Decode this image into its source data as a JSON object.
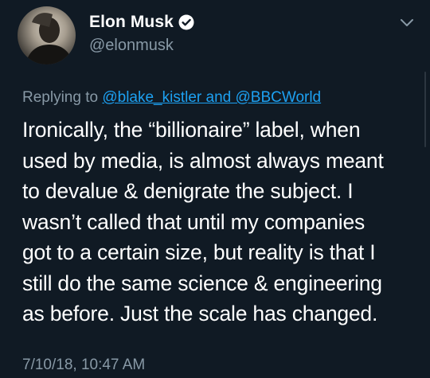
{
  "author": {
    "name": "Elon Musk",
    "handle": "@elonmusk",
    "verified": true
  },
  "reply": {
    "prefix": "Replying to",
    "mention": "@blake_kistler and @BBCWorld"
  },
  "tweet": {
    "lines": [
      "Ironically, the “billionaire” label, when",
      "used by media, is almost always meant",
      "to devalue & denigrate the subject. I",
      "wasn’t called that until my companies",
      "got to a certain size, but reality is that I",
      "still do the same science & engineering",
      "as before. Just the scale has changed."
    ]
  },
  "timestamp": "7/10/18, 10:47 AM",
  "colors": {
    "background": "#101a24",
    "text": "#ffffff",
    "muted": "#8899a6",
    "accent": "#1da1f2"
  },
  "icons": {
    "verified": "verified-badge-icon",
    "more": "chevron-down-icon"
  }
}
